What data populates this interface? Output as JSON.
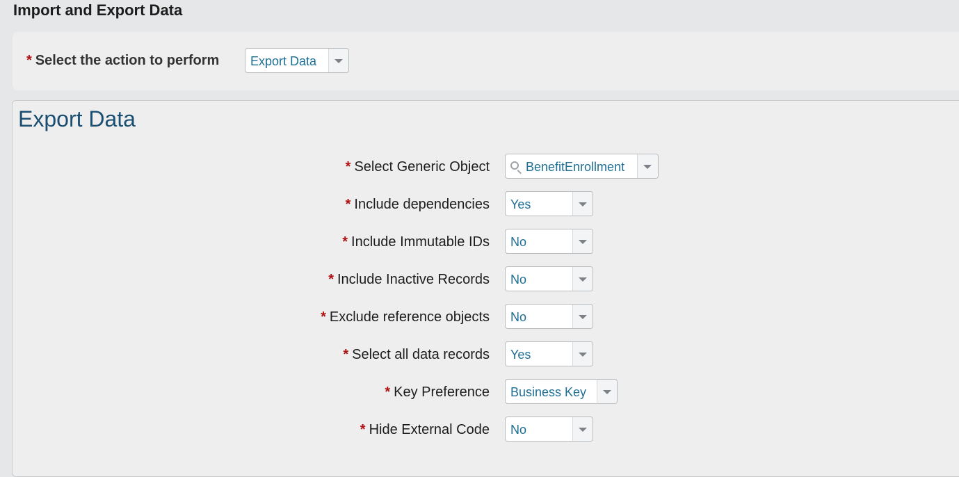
{
  "page": {
    "title": "Import and Export Data"
  },
  "action": {
    "label": "Select the action to perform",
    "required_marker": "*",
    "value": "Export Data"
  },
  "export": {
    "title": "Export Data",
    "fields": [
      {
        "label": "Select Generic Object",
        "value": "BenefitEnrollment",
        "icon": "search-icon"
      },
      {
        "label": "Include dependencies",
        "value": "Yes"
      },
      {
        "label": "Include Immutable IDs",
        "value": "No"
      },
      {
        "label": "Include Inactive Records",
        "value": "No"
      },
      {
        "label": "Exclude reference objects",
        "value": "No"
      },
      {
        "label": "Select all data records",
        "value": "Yes"
      },
      {
        "label": "Key Preference",
        "value": "Business Key"
      },
      {
        "label": "Hide External Code",
        "value": "No"
      }
    ]
  },
  "colors": {
    "required": "#b01010",
    "value_text": "#1f6f95",
    "section_title": "#1b4f72"
  }
}
